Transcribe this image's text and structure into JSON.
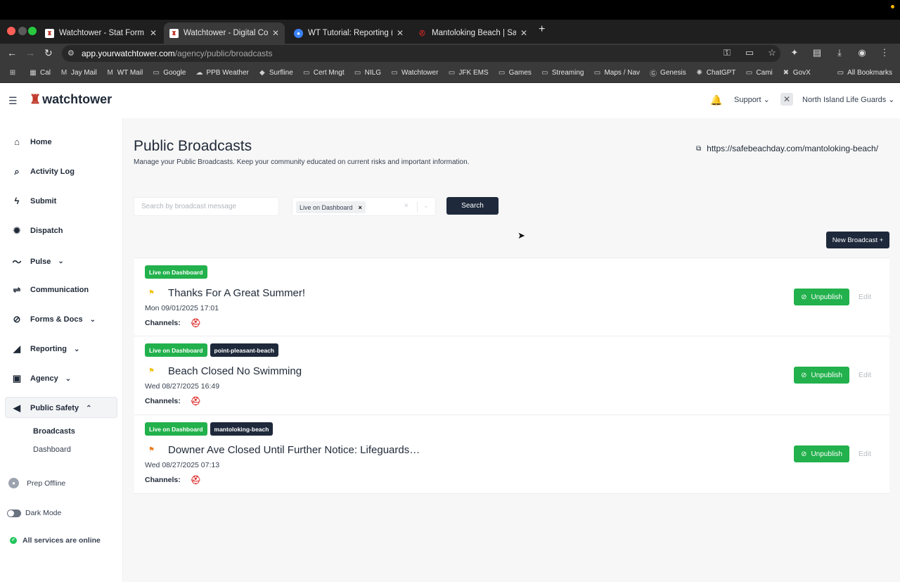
{
  "browser": {
    "tabs": [
      {
        "title": "Watchtower - Stat Form",
        "favicon": "watchtower-tab-icon",
        "active": false
      },
      {
        "title": "Watchtower - Digital Comma",
        "favicon": "watchtower-tab-icon",
        "active": true
      },
      {
        "title": "WT Tutorial: Reporting (raw)",
        "favicon": "tutorial-tab-icon",
        "active": false
      },
      {
        "title": "Mantoloking Beach | Safe Bea",
        "favicon": "safebeach-tab-icon",
        "active": false
      }
    ],
    "new_tab": "+",
    "url_host": "app.yourwatchtower.com",
    "url_path": "/agency/public/broadcasts",
    "bookmarks": [
      {
        "label": "Cal",
        "icon": "calendar-icon"
      },
      {
        "label": "Jay Mail",
        "icon": "gmail-icon"
      },
      {
        "label": "WT Mail",
        "icon": "gmail-icon"
      },
      {
        "label": "Google",
        "icon": "folder-icon"
      },
      {
        "label": "PPB Weather",
        "icon": "weather-icon"
      },
      {
        "label": "Surfline",
        "icon": "surfline-icon"
      },
      {
        "label": "Cert Mngt",
        "icon": "folder-icon"
      },
      {
        "label": "NILG",
        "icon": "folder-icon"
      },
      {
        "label": "Watchtower",
        "icon": "folder-icon"
      },
      {
        "label": "JFK EMS",
        "icon": "folder-icon"
      },
      {
        "label": "Games",
        "icon": "folder-icon"
      },
      {
        "label": "Streaming",
        "icon": "folder-icon"
      },
      {
        "label": "Maps / Nav",
        "icon": "folder-icon"
      },
      {
        "label": "Genesis",
        "icon": "genesis-icon"
      },
      {
        "label": "ChatGPT",
        "icon": "chatgpt-icon"
      },
      {
        "label": "Cami",
        "icon": "folder-icon"
      },
      {
        "label": "GovX",
        "icon": "govx-icon"
      }
    ],
    "all_bookmarks": "All Bookmarks"
  },
  "header": {
    "logo_text": "watchtower",
    "support": "Support",
    "agency": "North Island Life Guards"
  },
  "sidebar": {
    "items": [
      {
        "label": "Home",
        "icon": "home-icon",
        "chevron": ""
      },
      {
        "label": "Activity Log",
        "icon": "search-icon",
        "chevron": ""
      },
      {
        "label": "Submit",
        "icon": "bolt-icon",
        "chevron": ""
      },
      {
        "label": "Dispatch",
        "icon": "dispatch-icon",
        "chevron": ""
      },
      {
        "label": "Pulse",
        "icon": "pulse-icon",
        "chevron": "⌄"
      },
      {
        "label": "Communication",
        "icon": "communication-icon",
        "chevron": ""
      },
      {
        "label": "Forms & Docs",
        "icon": "paperclip-icon",
        "chevron": "⌄"
      },
      {
        "label": "Reporting",
        "icon": "chart-icon",
        "chevron": "⌄"
      },
      {
        "label": "Agency",
        "icon": "agency-icon",
        "chevron": "⌄"
      },
      {
        "label": "Public Safety",
        "icon": "megaphone-icon",
        "chevron": "⌃"
      }
    ],
    "sub_items": [
      "Broadcasts",
      "Dashboard"
    ],
    "prep_offline": "Prep Offline",
    "dark_mode": "Dark Mode",
    "status": "All services are online"
  },
  "main": {
    "title": "Public Broadcasts",
    "subtitle": "Manage your Public Broadcasts. Keep your community educated on current risks and important information.",
    "external_link": "https://safebeachday.com/mantoloking-beach/",
    "search_placeholder": "Search by broadcast message",
    "filter_chip": "Live on Dashboard",
    "search_button": "Search",
    "new_button": "New Broadcast +",
    "broadcasts": [
      {
        "badges": [
          "Live on Dashboard"
        ],
        "flag": "yellow-flag-icon",
        "title": "Thanks For A Great Summer!",
        "date": "Mon 09/01/2025 17:01",
        "channels_label": "Channels:",
        "unpublish": "Unpublish",
        "edit": "Edit"
      },
      {
        "badges": [
          "Live on Dashboard",
          "point-pleasant-beach"
        ],
        "flag": "yellow-flag-icon",
        "title": "Beach Closed No Swimming",
        "date": "Wed 08/27/2025 16:49",
        "channels_label": "Channels:",
        "unpublish": "Unpublish",
        "edit": "Edit"
      },
      {
        "badges": [
          "Live on Dashboard",
          "mantoloking-beach"
        ],
        "flag": "orange-flag-icon",
        "title": "Downer Ave Closed Until Further Notice: Lifeguards…",
        "date": "Wed 08/27/2025 07:13",
        "channels_label": "Channels:",
        "unpublish": "Unpublish",
        "edit": "Edit"
      }
    ]
  },
  "colors": {
    "green": "#22b14c",
    "navy": "#1e293b",
    "flag_yellow": "#f2c318",
    "flag_orange": "#f07a1a",
    "brand_red": "#c0392b"
  }
}
